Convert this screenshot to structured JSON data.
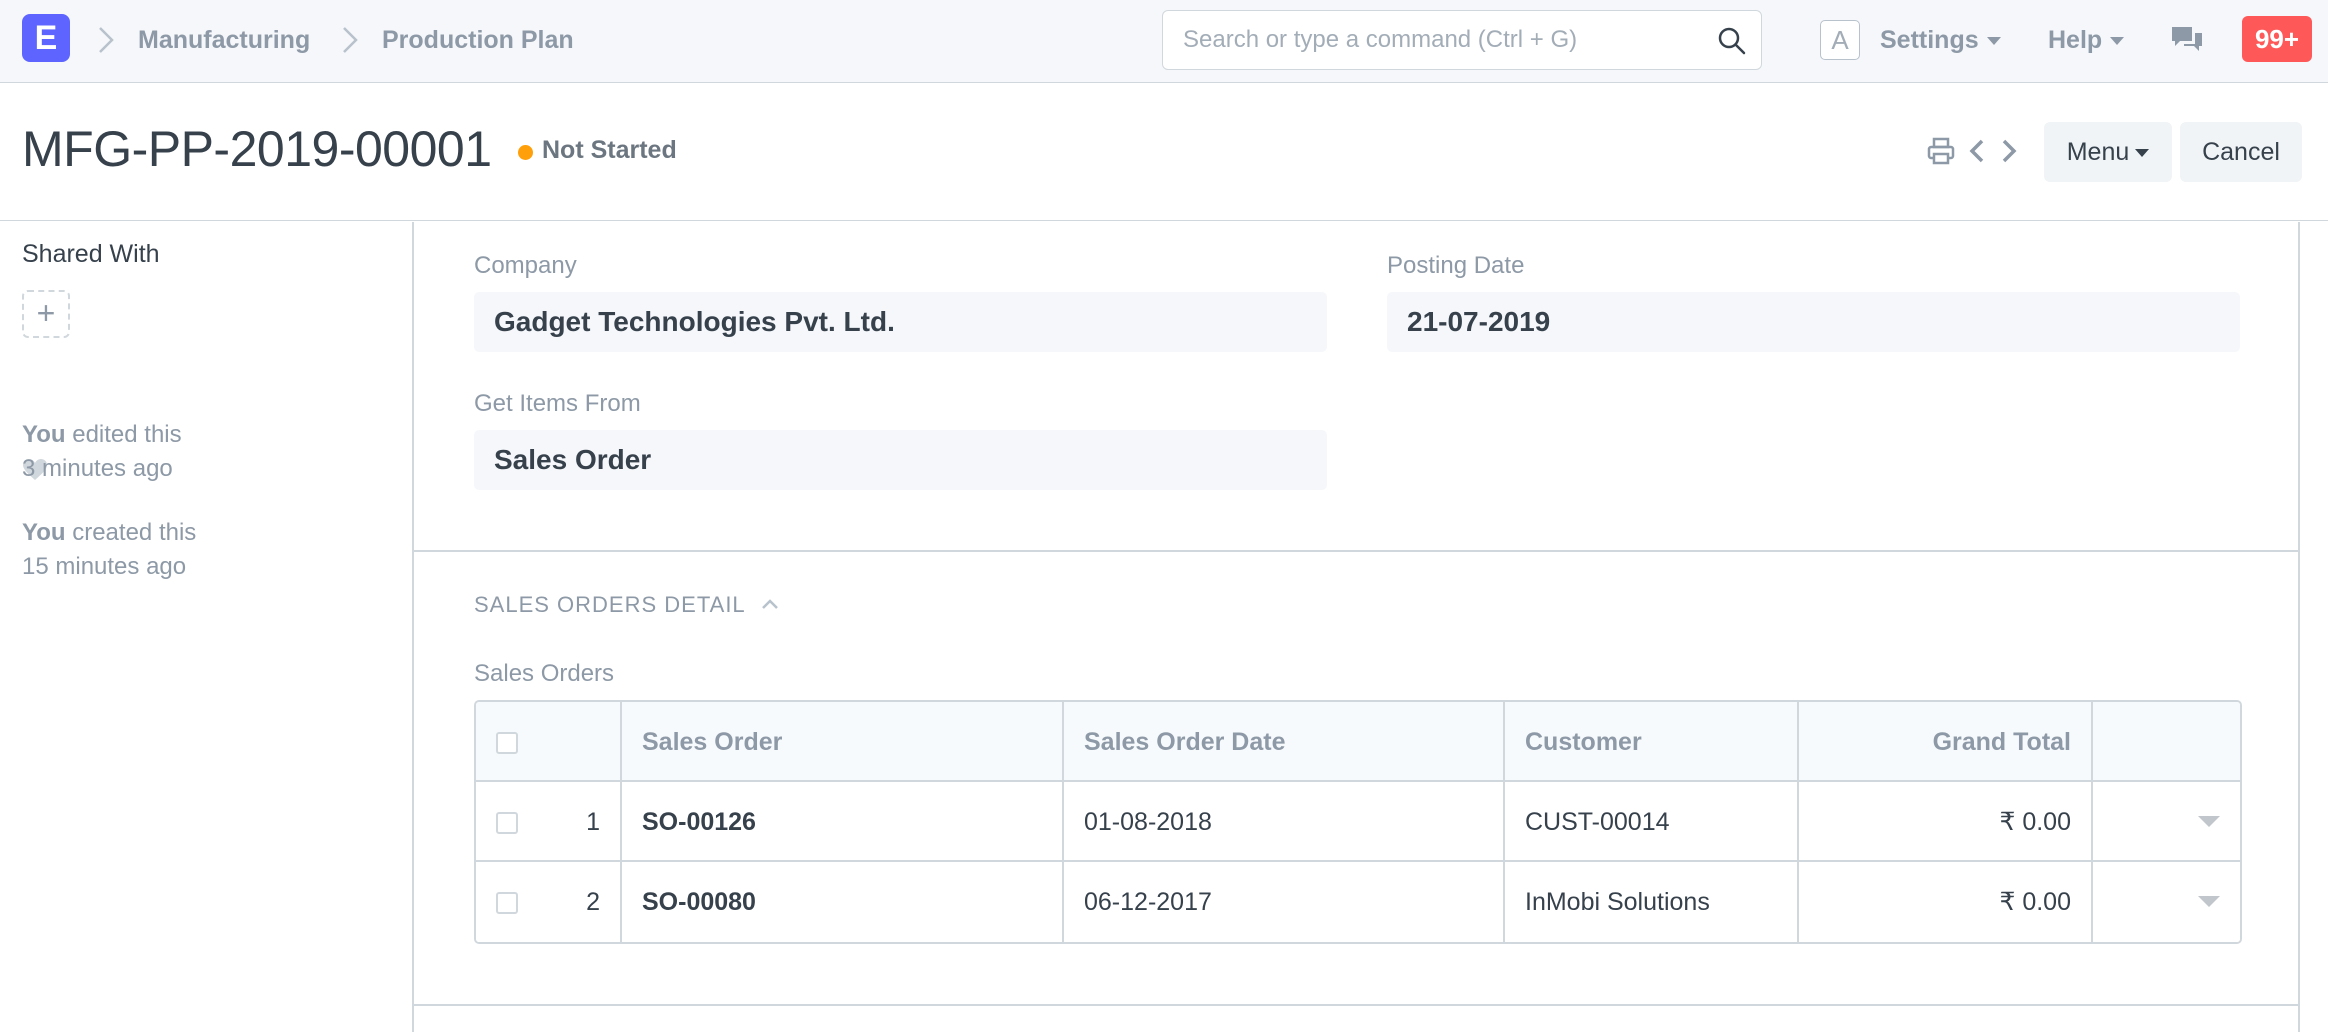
{
  "navbar": {
    "logo": "E",
    "breadcrumbs": [
      "Manufacturing",
      "Production Plan"
    ],
    "search_placeholder": "Search or type a command (Ctrl + G)",
    "avatar": "A",
    "settings": "Settings",
    "help": "Help",
    "notifications": "99+"
  },
  "page": {
    "title": "MFG-PP-2019-00001",
    "status": "Not Started",
    "status_color": "#ffa00a",
    "menu_label": "Menu",
    "cancel_label": "Cancel"
  },
  "sidebar": {
    "shared_with": "Shared With",
    "add_share": "+",
    "activity": [
      {
        "user": "You",
        "action": "edited this",
        "time": "3 minutes ago"
      },
      {
        "user": "You",
        "action": "created this",
        "time": "15 minutes ago"
      }
    ]
  },
  "form": {
    "company_label": "Company",
    "company_value": "Gadget Technologies Pvt. Ltd.",
    "posting_date_label": "Posting Date",
    "posting_date_value": "21-07-2019",
    "get_items_label": "Get Items From",
    "get_items_value": "Sales Order",
    "section_title": "SALES ORDERS DETAIL",
    "table_label": "Sales Orders"
  },
  "table": {
    "headers": [
      "Sales Order",
      "Sales Order Date",
      "Customer",
      "Grand Total"
    ],
    "rows": [
      {
        "idx": "1",
        "sales_order": "SO-00126",
        "date": "01-08-2018",
        "customer": "CUST-00014",
        "total": "₹ 0.00"
      },
      {
        "idx": "2",
        "sales_order": "SO-00080",
        "date": "06-12-2017",
        "customer": "InMobi Solutions",
        "total": "₹ 0.00"
      }
    ]
  },
  "colors": {
    "brand": "#5e64ff",
    "notification": "#ff5858",
    "status_not_started": "#ffa00a"
  }
}
